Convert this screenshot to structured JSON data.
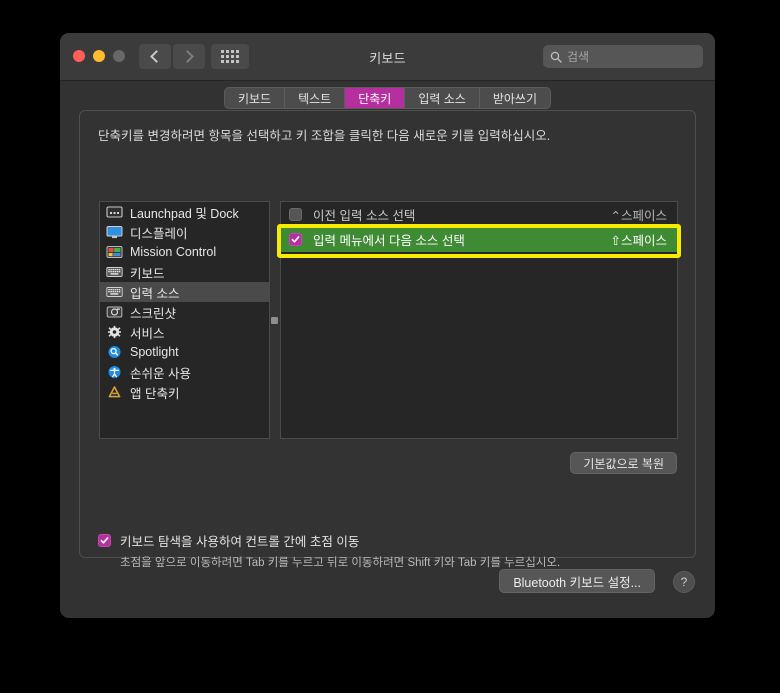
{
  "window": {
    "title": "키보드",
    "traffic_lights": [
      "close",
      "minimize",
      "maximize"
    ],
    "nav": {
      "back": "back-chevron",
      "forward": "forward-chevron",
      "grid": "show-all-grid"
    },
    "search": {
      "placeholder": "검색",
      "value": "",
      "icon": "search-icon"
    }
  },
  "tabs": [
    {
      "label": "키보드",
      "active": false
    },
    {
      "label": "텍스트",
      "active": false
    },
    {
      "label": "단축키",
      "active": true
    },
    {
      "label": "입력 소스",
      "active": false
    },
    {
      "label": "받아쓰기",
      "active": false
    }
  ],
  "hint": "단축키를 변경하려면 항목을 선택하고 키 조합을 클릭한 다음 새로운 키를 입력하십시오.",
  "sidebar": {
    "items": [
      {
        "label": "Launchpad 및 Dock",
        "icon": "launchpad-dock-icon",
        "selected": false
      },
      {
        "label": "디스플레이",
        "icon": "display-icon",
        "selected": false
      },
      {
        "label": "Mission Control",
        "icon": "mission-control-icon",
        "selected": false
      },
      {
        "label": "키보드",
        "icon": "keyboard-icon",
        "selected": false
      },
      {
        "label": "입력 소스",
        "icon": "input-sources-icon",
        "selected": true
      },
      {
        "label": "스크린샷",
        "icon": "screenshot-icon",
        "selected": false
      },
      {
        "label": "서비스",
        "icon": "services-gear-icon",
        "selected": false
      },
      {
        "label": "Spotlight",
        "icon": "spotlight-icon",
        "selected": false
      },
      {
        "label": "손쉬운 사용",
        "icon": "accessibility-icon",
        "selected": false
      },
      {
        "label": "앱 단축키",
        "icon": "app-shortcuts-icon",
        "selected": false
      }
    ]
  },
  "shortcuts": {
    "rows": [
      {
        "label": "이전 입력 소스 선택",
        "key": "⌃스페이스",
        "checked": false,
        "selected": false
      },
      {
        "label": "입력 메뉴에서 다음 소스 선택",
        "key": "⇧스페이스",
        "checked": true,
        "selected": true
      }
    ]
  },
  "restore_button": "기본값으로 복원",
  "keyboard_nav": {
    "label": "키보드 탐색을 사용하여 컨트롤 간에 초점 이동",
    "checked": true,
    "sub": "초점을 앞으로 이동하려면 Tab 키를 누르고 뒤로 이동하려면 Shift 키와 Tab 키를 누르십시오."
  },
  "footer": {
    "bluetooth_button": "Bluetooth 키보드 설정...",
    "help_button": "?"
  },
  "colors": {
    "accent_purple": "#b5309e",
    "selection_green": "#3f8b33",
    "highlight_yellow": "#f7ec00",
    "window_bg": "#323232",
    "list_bg": "#262626"
  }
}
